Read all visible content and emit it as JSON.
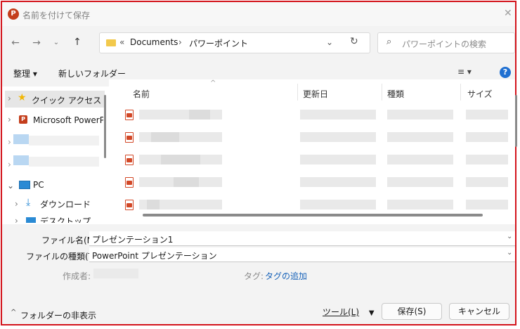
{
  "window": {
    "title": "名前を付けて保存",
    "app_icon_letter": "P"
  },
  "address": {
    "crumbs": [
      "Documents",
      "パワーポイント"
    ],
    "overflow": "«",
    "separator": "›"
  },
  "search": {
    "placeholder": "パワーポイントの検索"
  },
  "toolbar": {
    "organize": "整理 ▾",
    "new_folder": "新しいフォルダー",
    "view": "≡ ▾",
    "help": "?"
  },
  "sidebar": {
    "items": [
      {
        "label": "クイック アクセス",
        "icon": "star-icon",
        "selected": true
      },
      {
        "label": "Microsoft PowerP",
        "icon": "powerpoint-icon"
      },
      {
        "label": "",
        "icon": "blurred-icon"
      },
      {
        "label": "",
        "icon": "blurred-icon"
      },
      {
        "label": "PC",
        "icon": "pc-icon"
      },
      {
        "label": "ダウンロード",
        "icon": "download-icon"
      },
      {
        "label": "デスクトップ",
        "icon": "desktop-icon"
      }
    ]
  },
  "columns": {
    "name": "名前",
    "modified": "更新日",
    "type": "種類",
    "size": "サイズ"
  },
  "files": [
    {
      "icon": "pdf-icon"
    },
    {
      "icon": "pdf-icon"
    },
    {
      "icon": "pdf-icon"
    },
    {
      "icon": "pdf-icon"
    },
    {
      "icon": "pdf-icon"
    }
  ],
  "form": {
    "filename_label": "ファイル名(N):",
    "filename_value": "プレゼンテーション1",
    "filetype_label": "ファイルの種類(T):",
    "filetype_value": "PowerPoint プレゼンテーション",
    "author_label": "作成者:",
    "tags_label": "タグ:",
    "tags_link": "タグの追加"
  },
  "footer": {
    "hide_folders": "フォルダーの非表示",
    "tools": "ツール(L)",
    "save": "保存(S)",
    "cancel": "キャンセル"
  },
  "colors": {
    "accent": "#d3141c",
    "link": "#1561b8",
    "folder": "#f2c94c"
  }
}
